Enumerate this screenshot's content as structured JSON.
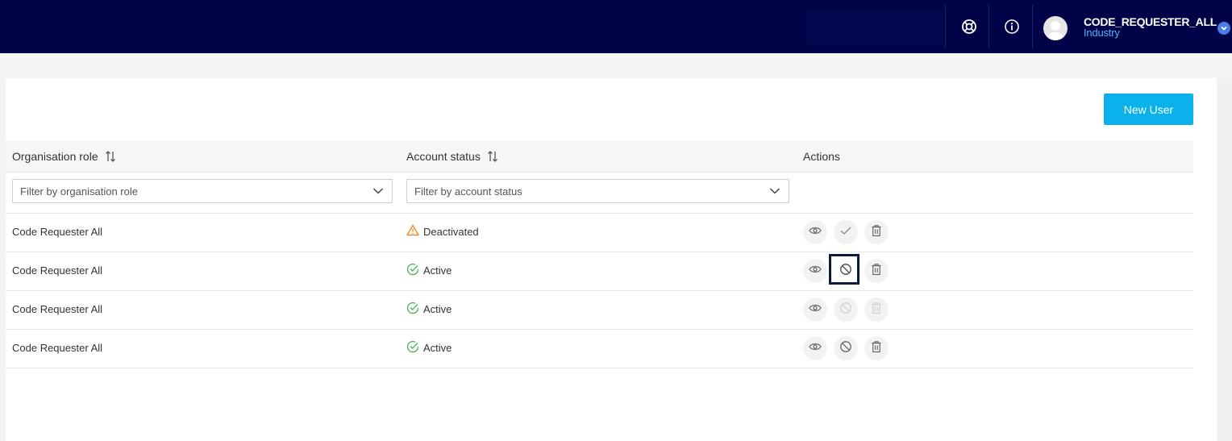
{
  "header": {
    "user": {
      "name": "CODE_REQUESTER_ALL",
      "organisation": "Industry"
    },
    "icons": [
      "lifebuoy-icon",
      "info-icon",
      "avatar",
      "chevron-down-icon"
    ]
  },
  "toolbar": {
    "new_user_label": "New User"
  },
  "table": {
    "columns": [
      {
        "label": "Organisation role",
        "sortable": true
      },
      {
        "label": "Account status",
        "sortable": true
      },
      {
        "label": "Actions",
        "sortable": false
      }
    ],
    "filters": {
      "role_placeholder": "Filter by organisation role",
      "status_placeholder": "Filter by account status"
    },
    "rows": [
      {
        "role": "Code Requester All",
        "status": "Deactivated",
        "status_icon": "warning-icon",
        "middle_action": "activate"
      },
      {
        "role": "Code Requester All",
        "status": "Active",
        "status_icon": "check-circle-icon",
        "middle_action": "deactivate",
        "focused": true
      },
      {
        "role": "Code Requester All",
        "status": "Active",
        "status_icon": "check-circle-icon",
        "middle_action": "deactivate",
        "disabled": true
      },
      {
        "role": "Code Requester All",
        "status": "Active",
        "status_icon": "check-circle-icon",
        "middle_action": "deactivate"
      }
    ]
  },
  "colors": {
    "topbar": "#000348",
    "accent": "#0bb1ea",
    "warning": "#f08a24",
    "success": "#4caf50",
    "username_secondary": "#4fb3ff"
  }
}
